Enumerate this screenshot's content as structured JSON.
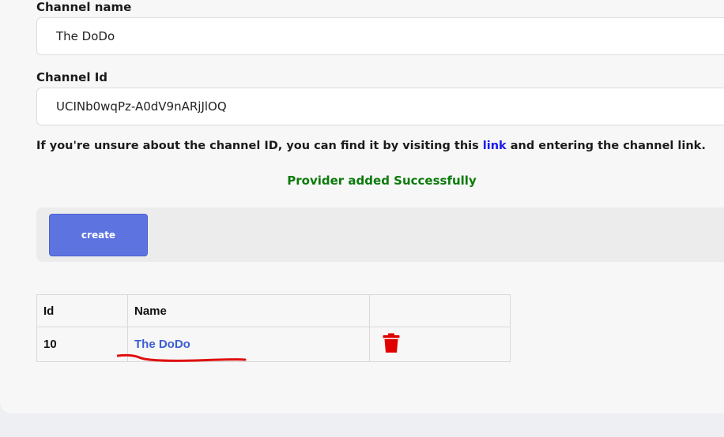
{
  "form": {
    "channel_name_label": "Channel name",
    "channel_name_value": "The DoDo",
    "channel_id_label": "Channel Id",
    "channel_id_value": "UCINb0wqPz-A0dV9nARjJlOQ",
    "hint_before": "If you're unsure about the channel ID, you can find it by visiting this ",
    "hint_link": "link",
    "hint_after": " and entering the channel link.",
    "success_message": "Provider added Successfully",
    "create_label": "create"
  },
  "table": {
    "headers": [
      "Id",
      "Name",
      ""
    ],
    "rows": [
      {
        "id": "10",
        "name": "The DoDo",
        "action_icon": "trash-icon"
      }
    ]
  },
  "colors": {
    "accent": "#5d74e0",
    "link": "#1a1aee",
    "success": "#0b7a0b",
    "delete": "#e00000",
    "annotation": "#e01010"
  }
}
